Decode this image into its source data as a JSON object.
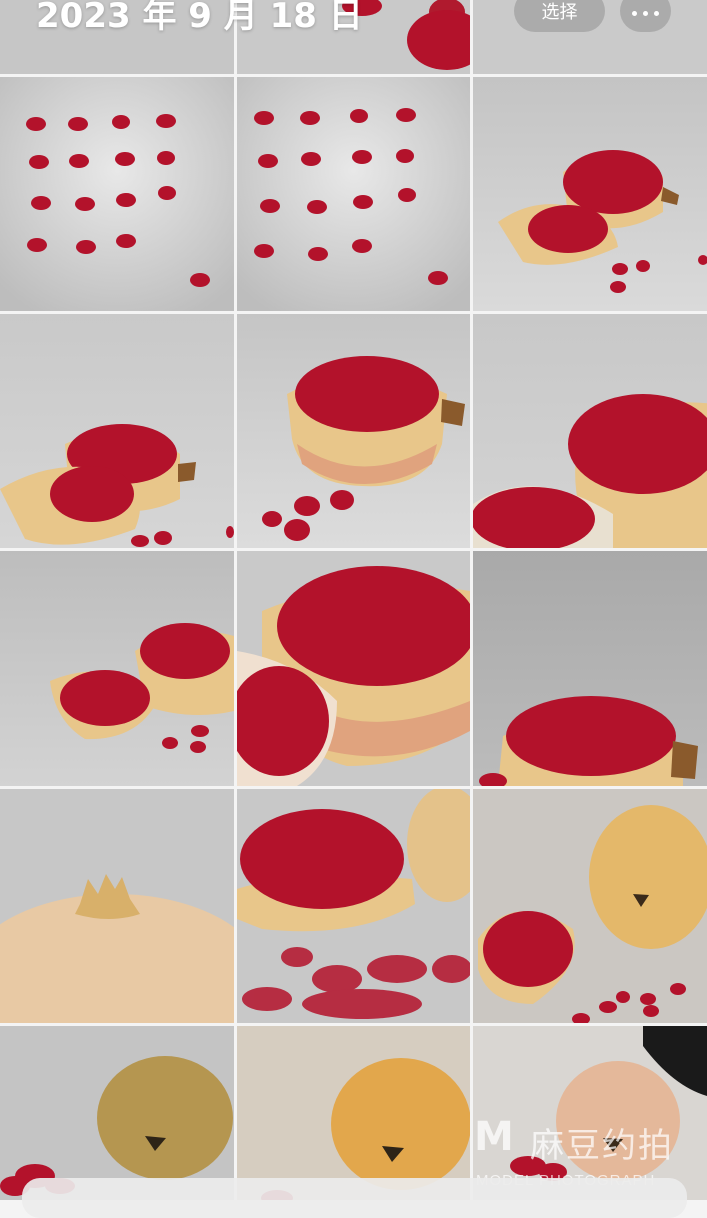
{
  "header": {
    "date_title": "2023 年 9 月 18 日",
    "select_label": "选择",
    "more_icon": "ellipsis-icon"
  },
  "photos": [
    {
      "name": "photo-pomegranate-seeds-top-1",
      "subject": "seeds-grid"
    },
    {
      "name": "photo-pomegranate-seeds-top-2",
      "subject": "seeds-grid"
    },
    {
      "name": "photo-pomegranate-broken-1",
      "subject": "broken-halves"
    },
    {
      "name": "photo-pomegranate-broken-2",
      "subject": "broken-halves"
    },
    {
      "name": "photo-pomegranate-bowl-1",
      "subject": "half-bowl"
    },
    {
      "name": "photo-pomegranate-closeup-1",
      "subject": "closeup"
    },
    {
      "name": "photo-pomegranate-pieces-1",
      "subject": "pieces"
    },
    {
      "name": "photo-pomegranate-closeup-2",
      "subject": "closeup"
    },
    {
      "name": "photo-pomegranate-half-dark",
      "subject": "half-dark"
    },
    {
      "name": "photo-pomegranate-whole-top",
      "subject": "whole-top"
    },
    {
      "name": "photo-pomegranate-half-whole",
      "subject": "half-whole"
    },
    {
      "name": "photo-pomegranate-whole-piece",
      "subject": "whole-piece"
    },
    {
      "name": "photo-pomegranate-whole-brown",
      "subject": "whole"
    },
    {
      "name": "photo-pomegranate-whole-orange",
      "subject": "whole"
    },
    {
      "name": "photo-pomegranate-whole-pink",
      "subject": "whole"
    }
  ],
  "watermark": {
    "logo": "M",
    "text": "麻豆约拍",
    "sub": "MODEL PHOTOGRAPH"
  },
  "colors": {
    "seed": "#b3122b",
    "rind": "#e8c68a",
    "background_gray": "#c9c9c9"
  }
}
